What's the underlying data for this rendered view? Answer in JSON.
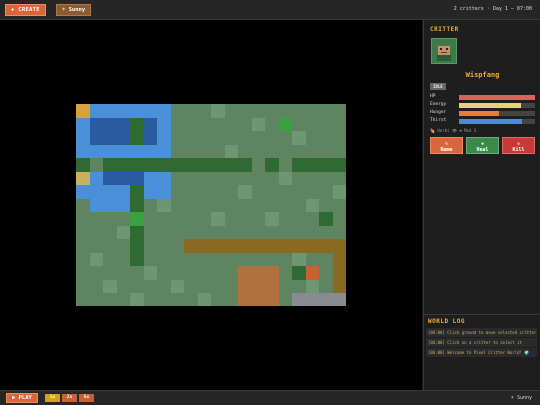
{
  "topbar": {
    "create_label": "✚ CREATE",
    "weather_label": "☀ Sunny",
    "status": "2 critters · Day 1 — 07:00"
  },
  "panel": {
    "title": "CRITTER",
    "critter_name": "Wispfang",
    "state": "IDLE",
    "stats": [
      {
        "label": "HP",
        "value": 1.0,
        "color": "#e06060"
      },
      {
        "label": "Energy",
        "value": 0.82,
        "color": "#e8d080"
      },
      {
        "label": "Hunger",
        "value": 0.52,
        "color": "#e08040"
      },
      {
        "label": "Thirst",
        "value": 0.83,
        "color": "#4a8ad8"
      }
    ],
    "info": "🍖 Herbi 👁 ❤ Mod 3",
    "actions": [
      {
        "icon": "✎",
        "label": "Name",
        "color": "#d9663a"
      },
      {
        "icon": "✚",
        "label": "Heal",
        "color": "#3a8a4a"
      },
      {
        "icon": "☠",
        "label": "Kill",
        "color": "#c83a3a"
      }
    ]
  },
  "log": {
    "title": "WORLD LOG",
    "entries": [
      "[06:00] Click ground to move selected critter",
      "[06:00] Click on a critter to select it",
      "[06:00] Welcome to Pixel Critter World! 🌍"
    ]
  },
  "bottombar": {
    "play_label": "▶ PLAY",
    "speeds": [
      "1x",
      "2x",
      "5x"
    ],
    "weather": "☀ Sunny"
  },
  "colors": {
    "accent": "#d9663a",
    "gold": "#f0b030",
    "grass": "#5e8560",
    "water": "#4a90d9",
    "deep_water": "#2a5aa0",
    "tree": "#2f6a34",
    "path": "#8a6a20"
  }
}
